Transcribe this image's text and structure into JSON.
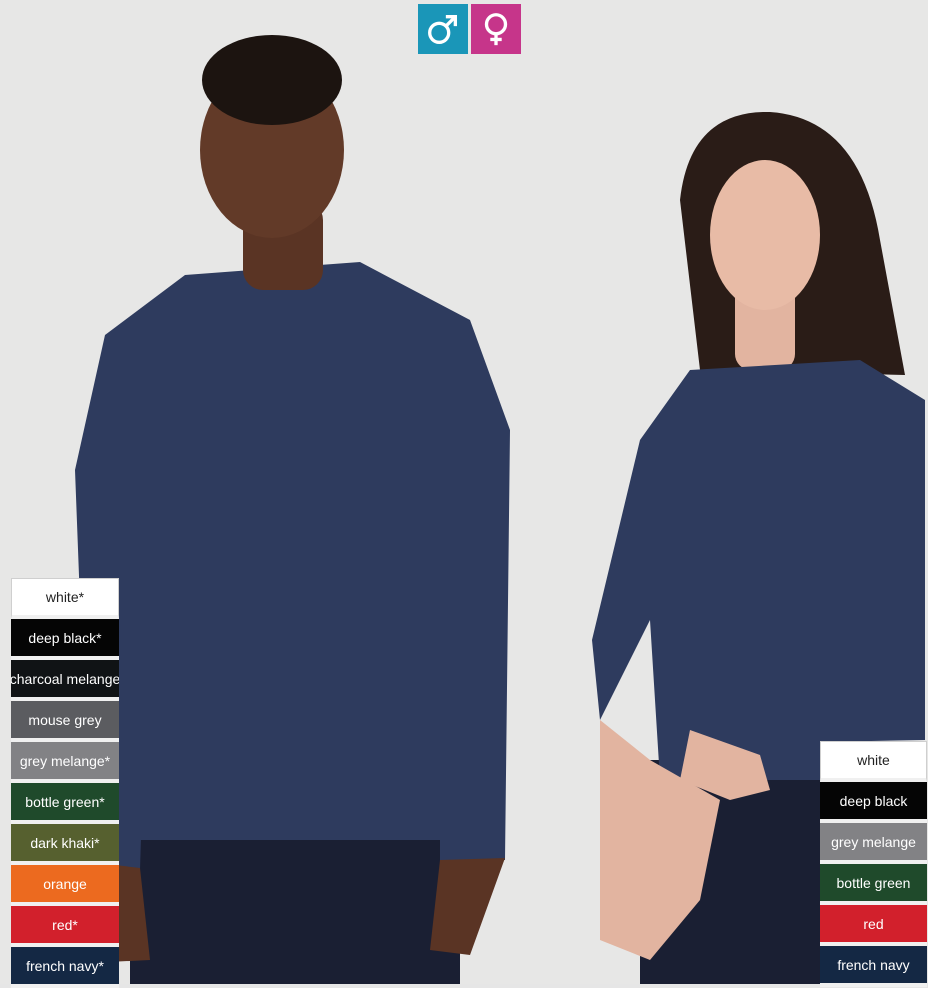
{
  "gender_toggle": {
    "male": {
      "icon": "male-symbol-icon",
      "color": "#1a96b8"
    },
    "female": {
      "icon": "female-symbol-icon",
      "color": "#c6358a"
    }
  },
  "men_colors": [
    {
      "label": "white*",
      "bg": "#ffffff",
      "fg": "#222222"
    },
    {
      "label": "deep black*",
      "bg": "#050505",
      "fg": "#ffffff"
    },
    {
      "label": "charcoal melange",
      "bg": "#101315",
      "fg": "#ffffff"
    },
    {
      "label": "mouse grey",
      "bg": "#5b5c60",
      "fg": "#ffffff"
    },
    {
      "label": "grey melange*",
      "bg": "#828285",
      "fg": "#ffffff"
    },
    {
      "label": "bottle green*",
      "bg": "#1f4a2b",
      "fg": "#ffffff"
    },
    {
      "label": "dark khaki*",
      "bg": "#56602f",
      "fg": "#ffffff"
    },
    {
      "label": "orange",
      "bg": "#ec6a1f",
      "fg": "#ffffff"
    },
    {
      "label": "red*",
      "bg": "#d2202c",
      "fg": "#ffffff"
    },
    {
      "label": "french navy*",
      "bg": "#142844",
      "fg": "#ffffff"
    }
  ],
  "women_colors": [
    {
      "label": "white",
      "bg": "#ffffff",
      "fg": "#222222"
    },
    {
      "label": "deep black",
      "bg": "#050505",
      "fg": "#ffffff"
    },
    {
      "label": "grey melange",
      "bg": "#828285",
      "fg": "#ffffff"
    },
    {
      "label": "bottle green",
      "bg": "#1f4a2b",
      "fg": "#ffffff"
    },
    {
      "label": "red",
      "bg": "#d2202c",
      "fg": "#ffffff"
    },
    {
      "label": "french navy",
      "bg": "#142844",
      "fg": "#ffffff"
    }
  ],
  "shirt_color": "#2e3b5e",
  "jeans_color": "#1a1f33"
}
